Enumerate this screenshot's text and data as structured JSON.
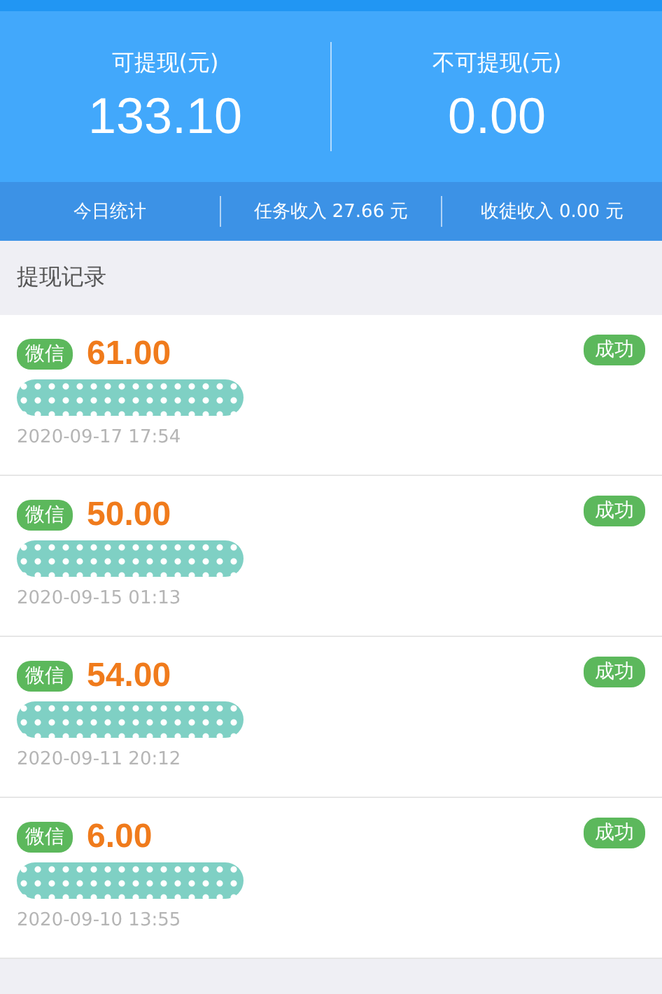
{
  "balances": [
    {
      "label": "可提现(元)",
      "value": "133.10"
    },
    {
      "label": "不可提现(元)",
      "value": "0.00"
    }
  ],
  "stats": [
    "今日统计",
    "任务收入 27.66 元",
    "收徒收入 0.00 元"
  ],
  "section_title": "提现记录",
  "records": [
    {
      "method": "微信",
      "amount": "61.00",
      "status": "成功",
      "date": "2020-09-17 17:54"
    },
    {
      "method": "微信",
      "amount": "50.00",
      "status": "成功",
      "date": "2020-09-15 01:13"
    },
    {
      "method": "微信",
      "amount": "54.00",
      "status": "成功",
      "date": "2020-09-11 20:12"
    },
    {
      "method": "微信",
      "amount": "6.00",
      "status": "成功",
      "date": "2020-09-10 13:55"
    }
  ]
}
